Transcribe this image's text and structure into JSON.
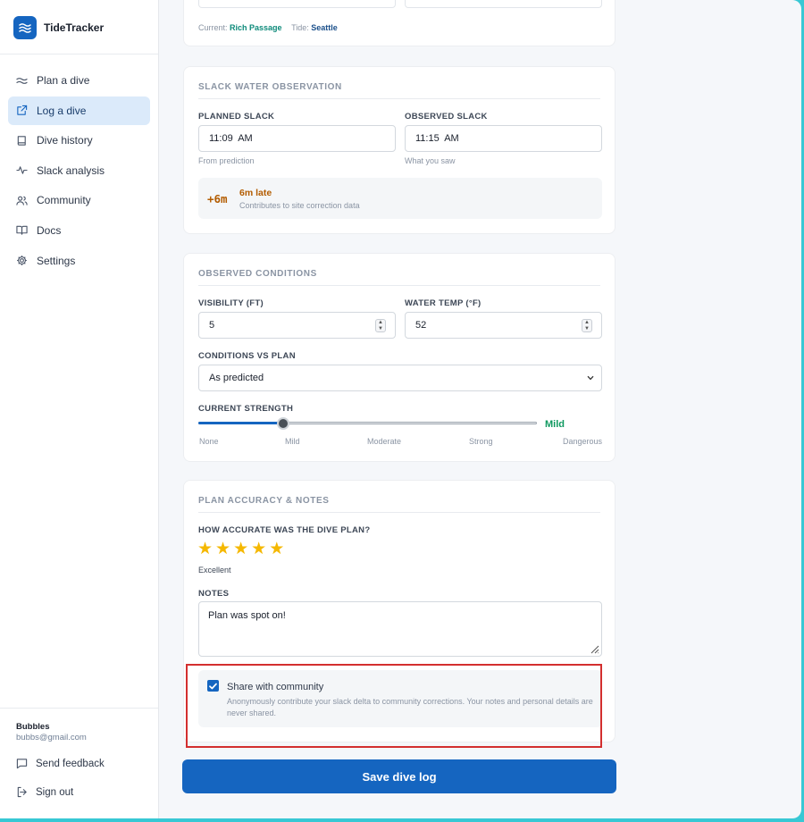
{
  "app": {
    "name": "TideTracker"
  },
  "sidebar": {
    "items": [
      {
        "label": "Plan a dive",
        "icon": "waves-icon"
      },
      {
        "label": "Log a dive",
        "icon": "external-link-icon",
        "active": true
      },
      {
        "label": "Dive history",
        "icon": "book-icon"
      },
      {
        "label": "Slack analysis",
        "icon": "activity-icon"
      },
      {
        "label": "Community",
        "icon": "users-icon"
      },
      {
        "label": "Docs",
        "icon": "open-book-icon"
      },
      {
        "label": "Settings",
        "icon": "gear-icon"
      }
    ],
    "user": {
      "name": "Bubbles",
      "email": "bubbs@gmail.com"
    },
    "send_feedback": "Send feedback",
    "sign_out": "Sign out"
  },
  "site_card": {
    "current_label": "Current:",
    "current_value": "Rich Passage",
    "tide_label": "Tide:",
    "tide_value": "Seattle"
  },
  "slack": {
    "title": "SLACK WATER OBSERVATION",
    "planned_label": "PLANNED SLACK",
    "planned_value": "11:09  AM",
    "planned_hint": "From prediction",
    "observed_label": "OBSERVED SLACK",
    "observed_value": "11:15  AM",
    "observed_hint": "What you saw",
    "delta": "+6m",
    "delta_text": "6m late",
    "delta_sub": "Contributes to site correction data"
  },
  "conditions": {
    "title": "OBSERVED CONDITIONS",
    "visibility_label": "VISIBILITY (FT)",
    "visibility_value": "5",
    "temp_label": "WATER TEMP (°F)",
    "temp_value": "52",
    "vs_plan_label": "CONDITIONS VS PLAN",
    "vs_plan_value": "As predicted",
    "strength_label": "CURRENT STRENGTH",
    "strength_value": "Mild",
    "strength_level": 0.25,
    "scale": [
      "None",
      "Mild",
      "Moderate",
      "Strong",
      "Dangerous"
    ]
  },
  "accuracy": {
    "title": "PLAN ACCURACY & NOTES",
    "question": "HOW ACCURATE WAS THE DIVE PLAN?",
    "stars": 5,
    "stars_max": 5,
    "rating_label": "Excellent",
    "notes_label": "NOTES",
    "notes_value": "Plan was spot on!",
    "share_label": "Share with community",
    "share_checked": true,
    "share_desc": "Anonymously contribute your slack delta to community corrections. Your notes and personal details are never shared."
  },
  "save_button": "Save dive log",
  "colors": {
    "primary": "#1565c0",
    "accent_teal": "#0d8a7a",
    "delta": "#b35c00",
    "mild": "#0f9960",
    "star": "#f5b800",
    "highlight_box": "#d32f2f",
    "window_border": "#38c8d4"
  }
}
